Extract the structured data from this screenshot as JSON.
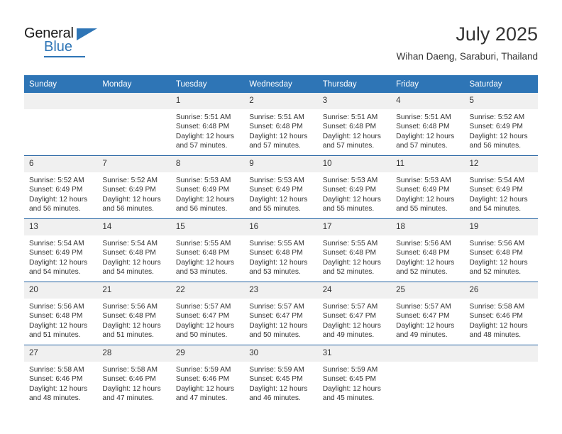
{
  "brand": {
    "name_top": "General",
    "name_bottom": "Blue",
    "accent_color": "#2e75b6"
  },
  "header": {
    "title": "July 2025",
    "subtitle": "Wihan Daeng, Saraburi, Thailand"
  },
  "calendar": {
    "weekday_headers": [
      "Sunday",
      "Monday",
      "Tuesday",
      "Wednesday",
      "Thursday",
      "Friday",
      "Saturday"
    ],
    "header_bg": "#2e75b6",
    "header_text": "#ffffff",
    "daynum_bg": "#f0f0f0",
    "row_divider": "#1f5fa0",
    "labels": {
      "sunrise": "Sunrise:",
      "sunset": "Sunset:",
      "daylight": "Daylight:"
    },
    "weeks": [
      [
        {
          "day": "",
          "empty": true
        },
        {
          "day": "",
          "empty": true
        },
        {
          "day": "1",
          "sunrise": "Sunrise: 5:51 AM",
          "sunset": "Sunset: 6:48 PM",
          "daylight": "Daylight: 12 hours and 57 minutes."
        },
        {
          "day": "2",
          "sunrise": "Sunrise: 5:51 AM",
          "sunset": "Sunset: 6:48 PM",
          "daylight": "Daylight: 12 hours and 57 minutes."
        },
        {
          "day": "3",
          "sunrise": "Sunrise: 5:51 AM",
          "sunset": "Sunset: 6:48 PM",
          "daylight": "Daylight: 12 hours and 57 minutes."
        },
        {
          "day": "4",
          "sunrise": "Sunrise: 5:51 AM",
          "sunset": "Sunset: 6:48 PM",
          "daylight": "Daylight: 12 hours and 57 minutes."
        },
        {
          "day": "5",
          "sunrise": "Sunrise: 5:52 AM",
          "sunset": "Sunset: 6:49 PM",
          "daylight": "Daylight: 12 hours and 56 minutes."
        }
      ],
      [
        {
          "day": "6",
          "sunrise": "Sunrise: 5:52 AM",
          "sunset": "Sunset: 6:49 PM",
          "daylight": "Daylight: 12 hours and 56 minutes."
        },
        {
          "day": "7",
          "sunrise": "Sunrise: 5:52 AM",
          "sunset": "Sunset: 6:49 PM",
          "daylight": "Daylight: 12 hours and 56 minutes."
        },
        {
          "day": "8",
          "sunrise": "Sunrise: 5:53 AM",
          "sunset": "Sunset: 6:49 PM",
          "daylight": "Daylight: 12 hours and 56 minutes."
        },
        {
          "day": "9",
          "sunrise": "Sunrise: 5:53 AM",
          "sunset": "Sunset: 6:49 PM",
          "daylight": "Daylight: 12 hours and 55 minutes."
        },
        {
          "day": "10",
          "sunrise": "Sunrise: 5:53 AM",
          "sunset": "Sunset: 6:49 PM",
          "daylight": "Daylight: 12 hours and 55 minutes."
        },
        {
          "day": "11",
          "sunrise": "Sunrise: 5:53 AM",
          "sunset": "Sunset: 6:49 PM",
          "daylight": "Daylight: 12 hours and 55 minutes."
        },
        {
          "day": "12",
          "sunrise": "Sunrise: 5:54 AM",
          "sunset": "Sunset: 6:49 PM",
          "daylight": "Daylight: 12 hours and 54 minutes."
        }
      ],
      [
        {
          "day": "13",
          "sunrise": "Sunrise: 5:54 AM",
          "sunset": "Sunset: 6:49 PM",
          "daylight": "Daylight: 12 hours and 54 minutes."
        },
        {
          "day": "14",
          "sunrise": "Sunrise: 5:54 AM",
          "sunset": "Sunset: 6:48 PM",
          "daylight": "Daylight: 12 hours and 54 minutes."
        },
        {
          "day": "15",
          "sunrise": "Sunrise: 5:55 AM",
          "sunset": "Sunset: 6:48 PM",
          "daylight": "Daylight: 12 hours and 53 minutes."
        },
        {
          "day": "16",
          "sunrise": "Sunrise: 5:55 AM",
          "sunset": "Sunset: 6:48 PM",
          "daylight": "Daylight: 12 hours and 53 minutes."
        },
        {
          "day": "17",
          "sunrise": "Sunrise: 5:55 AM",
          "sunset": "Sunset: 6:48 PM",
          "daylight": "Daylight: 12 hours and 52 minutes."
        },
        {
          "day": "18",
          "sunrise": "Sunrise: 5:56 AM",
          "sunset": "Sunset: 6:48 PM",
          "daylight": "Daylight: 12 hours and 52 minutes."
        },
        {
          "day": "19",
          "sunrise": "Sunrise: 5:56 AM",
          "sunset": "Sunset: 6:48 PM",
          "daylight": "Daylight: 12 hours and 52 minutes."
        }
      ],
      [
        {
          "day": "20",
          "sunrise": "Sunrise: 5:56 AM",
          "sunset": "Sunset: 6:48 PM",
          "daylight": "Daylight: 12 hours and 51 minutes."
        },
        {
          "day": "21",
          "sunrise": "Sunrise: 5:56 AM",
          "sunset": "Sunset: 6:48 PM",
          "daylight": "Daylight: 12 hours and 51 minutes."
        },
        {
          "day": "22",
          "sunrise": "Sunrise: 5:57 AM",
          "sunset": "Sunset: 6:47 PM",
          "daylight": "Daylight: 12 hours and 50 minutes."
        },
        {
          "day": "23",
          "sunrise": "Sunrise: 5:57 AM",
          "sunset": "Sunset: 6:47 PM",
          "daylight": "Daylight: 12 hours and 50 minutes."
        },
        {
          "day": "24",
          "sunrise": "Sunrise: 5:57 AM",
          "sunset": "Sunset: 6:47 PM",
          "daylight": "Daylight: 12 hours and 49 minutes."
        },
        {
          "day": "25",
          "sunrise": "Sunrise: 5:57 AM",
          "sunset": "Sunset: 6:47 PM",
          "daylight": "Daylight: 12 hours and 49 minutes."
        },
        {
          "day": "26",
          "sunrise": "Sunrise: 5:58 AM",
          "sunset": "Sunset: 6:46 PM",
          "daylight": "Daylight: 12 hours and 48 minutes."
        }
      ],
      [
        {
          "day": "27",
          "sunrise": "Sunrise: 5:58 AM",
          "sunset": "Sunset: 6:46 PM",
          "daylight": "Daylight: 12 hours and 48 minutes."
        },
        {
          "day": "28",
          "sunrise": "Sunrise: 5:58 AM",
          "sunset": "Sunset: 6:46 PM",
          "daylight": "Daylight: 12 hours and 47 minutes."
        },
        {
          "day": "29",
          "sunrise": "Sunrise: 5:59 AM",
          "sunset": "Sunset: 6:46 PM",
          "daylight": "Daylight: 12 hours and 47 minutes."
        },
        {
          "day": "30",
          "sunrise": "Sunrise: 5:59 AM",
          "sunset": "Sunset: 6:45 PM",
          "daylight": "Daylight: 12 hours and 46 minutes."
        },
        {
          "day": "31",
          "sunrise": "Sunrise: 5:59 AM",
          "sunset": "Sunset: 6:45 PM",
          "daylight": "Daylight: 12 hours and 45 minutes."
        },
        {
          "day": "",
          "empty": true
        },
        {
          "day": "",
          "empty": true
        }
      ]
    ]
  }
}
